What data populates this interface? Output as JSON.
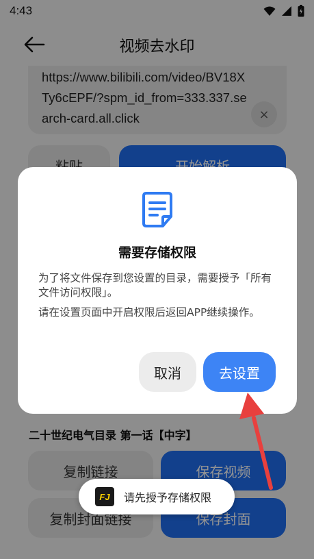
{
  "status_bar": {
    "time": "4:43"
  },
  "header": {
    "title": "视频去水印"
  },
  "url_input": {
    "value": "https://www.bilibili.com/video/BV18XTy6cEPF/?spm_id_from=333.337.search-card.all.click",
    "clear_label": "×"
  },
  "actions": {
    "paste_label": "粘贴",
    "parse_label": "开始解析"
  },
  "video": {
    "title": "二十世纪电气目录 第一话【中字】"
  },
  "result_actions": {
    "copy_link_label": "复制链接",
    "save_video_label": "保存视频",
    "copy_cover_link_label": "复制封面链接",
    "save_cover_label": "保存封面"
  },
  "dialog": {
    "icon": "document-icon",
    "title": "需要存储权限",
    "message1": "为了将文件保存到您设置的目录，需要授予「所有文件访问权限」。",
    "message2": "请在设置页面中开启权限后返回APP继续操作。",
    "cancel_label": "取消",
    "confirm_label": "去设置"
  },
  "toast": {
    "logo_text": "FJ",
    "text": "请先授予存储权限"
  },
  "colors": {
    "primary": "#1f6ff2",
    "dialog_confirm": "#3d84f5",
    "annotation_arrow": "#e8403e"
  }
}
